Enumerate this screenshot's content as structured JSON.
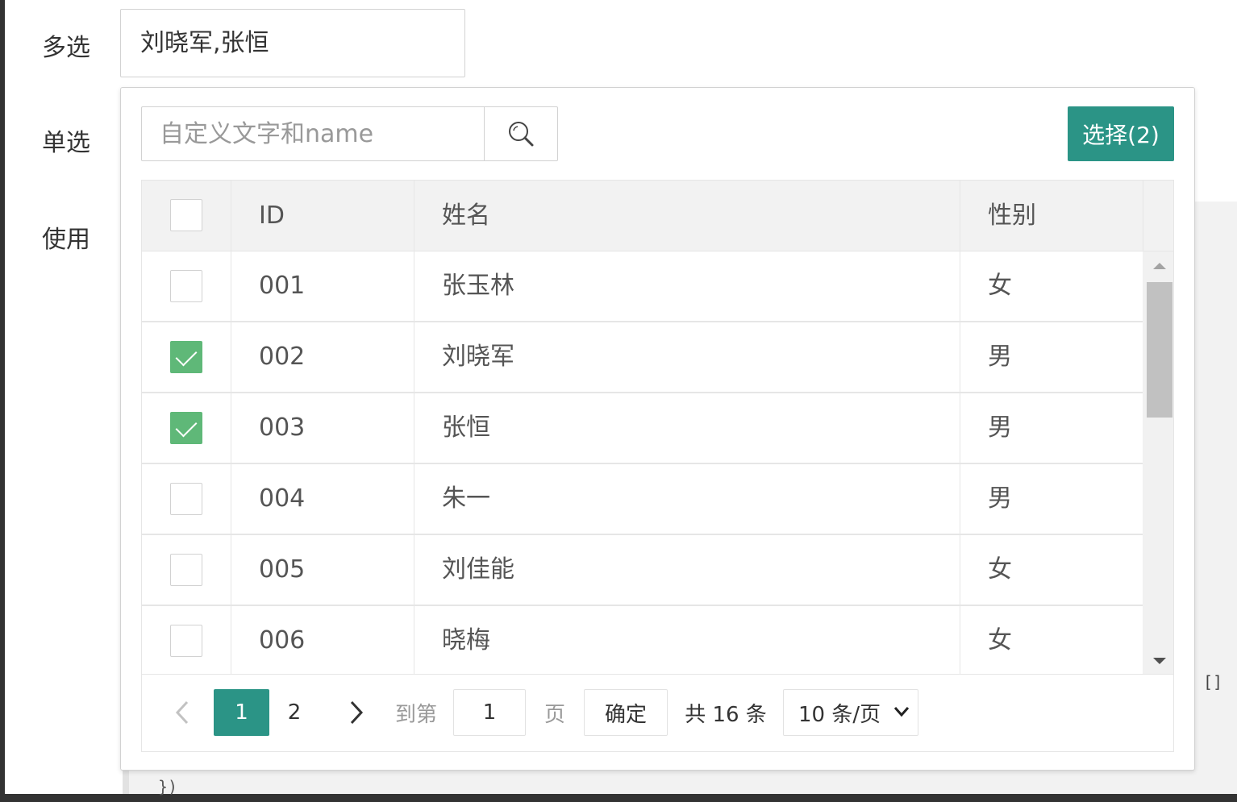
{
  "form": {
    "multi_label": "多选",
    "single_label": "单选",
    "use_label": "使用",
    "multi_value": "刘晓军,张恒"
  },
  "dropdown": {
    "search_placeholder": "自定义文字和name",
    "select_button": "选择(2)",
    "columns": [
      "ID",
      "姓名",
      "性别"
    ],
    "rows": [
      {
        "id": "001",
        "name": "张玉林",
        "gender": "女",
        "checked": false
      },
      {
        "id": "002",
        "name": "刘晓军",
        "gender": "男",
        "checked": true
      },
      {
        "id": "003",
        "name": "张恒",
        "gender": "男",
        "checked": true
      },
      {
        "id": "004",
        "name": "朱一",
        "gender": "男",
        "checked": false
      },
      {
        "id": "005",
        "name": "刘佳能",
        "gender": "女",
        "checked": false
      },
      {
        "id": "006",
        "name": "晓梅",
        "gender": "女",
        "checked": false
      }
    ],
    "pager": {
      "current_page": "1",
      "next_page": "2",
      "goto_label": "到第",
      "goto_value": "1",
      "page_suffix": "页",
      "confirm_label": "确定",
      "total_label": "共 16 条",
      "page_size": "10 条/页"
    }
  },
  "code": {
    "bracket": "[]",
    "tail": "})"
  }
}
